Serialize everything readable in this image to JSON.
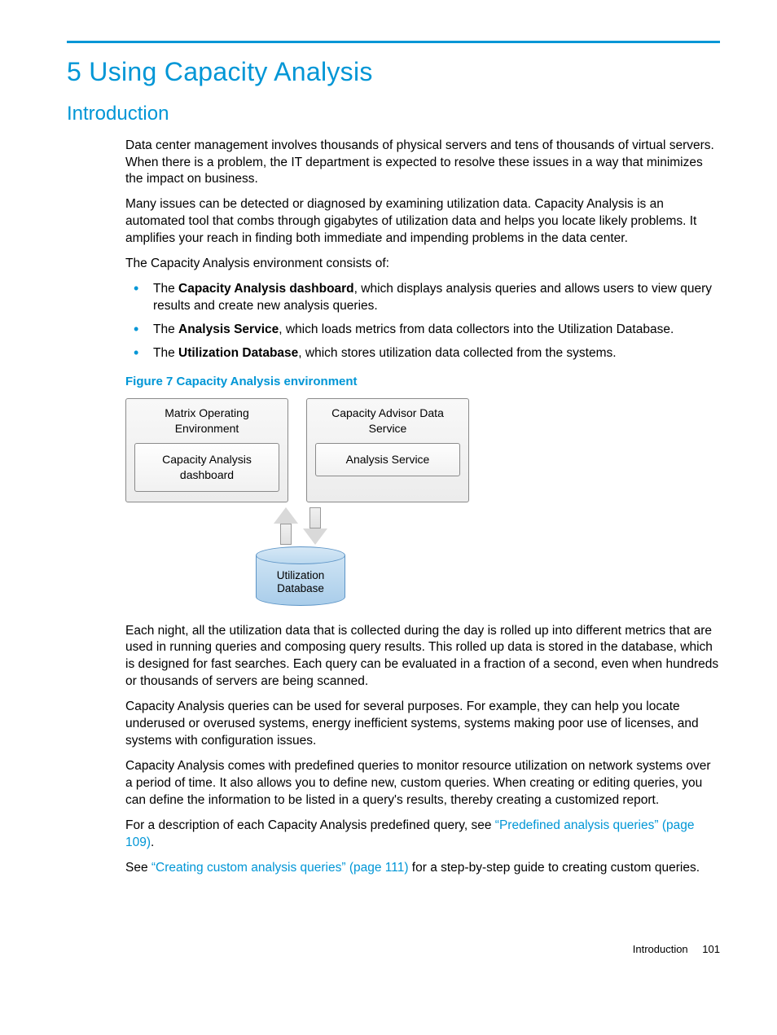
{
  "chapter": {
    "title": "5 Using Capacity Analysis"
  },
  "section": {
    "title": "Introduction"
  },
  "paras": {
    "p1": "Data center management involves thousands of physical servers and tens of thousands of virtual servers. When there is a problem, the IT department is expected to resolve these issues in a way that minimizes the impact on business.",
    "p2": "Many issues can be detected or diagnosed by examining utilization data. Capacity Analysis is an automated tool that combs through gigabytes of utilization data and helps you locate likely problems. It amplifies your reach in finding both immediate and impending problems in the data center.",
    "p3": "The Capacity Analysis environment consists of:",
    "p4": "Each night, all the utilization data that is collected during the day is rolled up into different metrics that are used in running queries and composing query results. This rolled up data is stored in the database, which is designed for fast searches. Each query can be evaluated in a fraction of a second, even when hundreds or thousands of servers are being scanned.",
    "p5": "Capacity Analysis queries can be used for several purposes. For example, they can help you locate underused or overused systems, energy inefficient systems, systems making poor use of licenses, and systems with configuration issues.",
    "p6": "Capacity Analysis comes with predefined queries to monitor resource utilization on network systems over a period of time. It also allows you to define new, custom queries. When creating or editing queries, you can define the information to be listed in a query's results, thereby creating a customized report.",
    "p7_pre": "For a description of each Capacity Analysis predefined query, see ",
    "p7_link": "“Predefined analysis queries” (page 109)",
    "p7_post": ".",
    "p8_pre": "See ",
    "p8_link": "“Creating custom analysis queries” (page 111)",
    "p8_post": " for a step-by-step guide to creating custom queries."
  },
  "bullets": {
    "b1_pre": "The ",
    "b1_bold": "Capacity Analysis dashboard",
    "b1_post": ", which displays analysis queries and allows users to view query results and create new analysis queries.",
    "b2_pre": "The ",
    "b2_bold": "Analysis Service",
    "b2_post": ", which loads metrics from data collectors into the Utilization Database.",
    "b3_pre": "The ",
    "b3_bold": "Utilization Database",
    "b3_post": ", which stores utilization data collected from the systems."
  },
  "figure": {
    "caption": "Figure 7 Capacity Analysis environment",
    "left_outer": "Matrix Operating Environment",
    "left_inner": "Capacity Analysis dashboard",
    "right_outer": "Capacity Advisor Data Service",
    "right_inner": "Analysis Service",
    "db_line1": "Utilization",
    "db_line2": "Database"
  },
  "footer": {
    "label": "Introduction",
    "page": "101"
  }
}
